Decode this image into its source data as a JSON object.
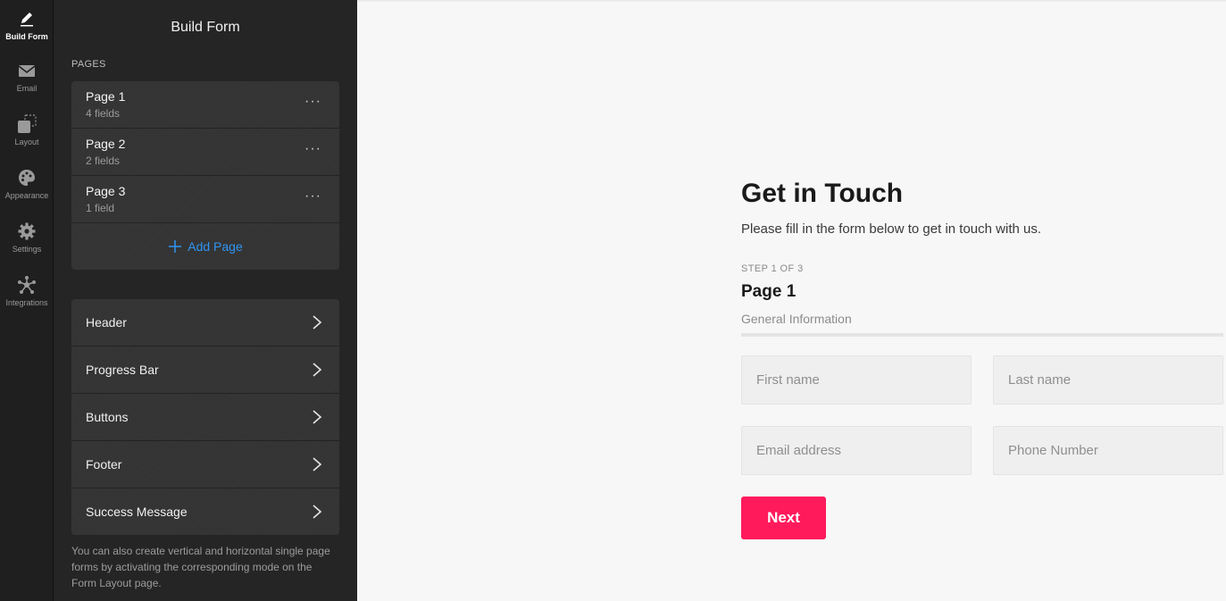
{
  "rail": {
    "items": [
      {
        "label": "Build Form",
        "icon": "pencil-icon",
        "active": true
      },
      {
        "label": "Email",
        "icon": "envelope-icon"
      },
      {
        "label": "Layout",
        "icon": "layout-icon"
      },
      {
        "label": "Appearance",
        "icon": "palette-icon"
      },
      {
        "label": "Settings",
        "icon": "gear-icon"
      },
      {
        "label": "Integrations",
        "icon": "integrations-icon"
      }
    ]
  },
  "panel": {
    "title": "Build Form",
    "pages_label": "PAGES",
    "pages": [
      {
        "name": "Page 1",
        "fields": "4 fields"
      },
      {
        "name": "Page 2",
        "fields": "2 fields"
      },
      {
        "name": "Page 3",
        "fields": "1 field"
      }
    ],
    "more_label": "···",
    "add_page": "Add Page",
    "settings": [
      {
        "label": "Header"
      },
      {
        "label": "Progress Bar"
      },
      {
        "label": "Buttons"
      },
      {
        "label": "Footer"
      },
      {
        "label": "Success Message"
      }
    ],
    "hint": "You can also create vertical and horizontal single page forms by activating the corresponding mode on the Form Layout page."
  },
  "form": {
    "title": "Get in Touch",
    "description": "Please fill in the form below to get in touch with us.",
    "step": "STEP 1 OF 3",
    "page_title": "Page 1",
    "page_description": "General Information",
    "progress": 0,
    "fields": {
      "first_name": {
        "placeholder": "First name",
        "value": ""
      },
      "last_name": {
        "placeholder": "Last name",
        "value": ""
      },
      "email": {
        "placeholder": "Email address",
        "value": ""
      },
      "phone": {
        "placeholder": "Phone Number",
        "value": ""
      }
    },
    "next_label": "Next"
  },
  "colors": {
    "accent": "#ff1a5c",
    "link": "#2f95f3",
    "rail_bg": "#1f1f1f",
    "panel_bg": "#252525",
    "card_bg": "#333333"
  }
}
